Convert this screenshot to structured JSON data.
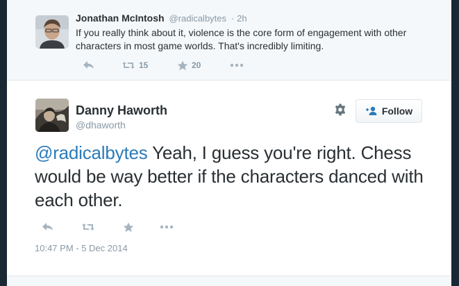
{
  "parent_tweet": {
    "author_name": "Jonathan McIntosh",
    "author_handle": "@radicalbytes",
    "separator": "·",
    "age": "2h",
    "text": "If you really think about it, violence is the core form of engagement with other characters in most game worlds. That's incredibly limiting.",
    "retweet_count": "15",
    "favorite_count": "20"
  },
  "main_tweet": {
    "author_name": "Danny Haworth",
    "author_handle": "@dhaworth",
    "follow_label": "Follow",
    "mention": "@radicalbytes",
    "text": " Yeah, I guess you're right. Chess would be way better if the characters danced with each other.",
    "timestamp": "10:47 PM - 5 Dec 2014"
  },
  "colors": {
    "link": "#2b7bb9",
    "icon": "#a6b4c0",
    "muted": "#8899a6",
    "text": "#292f33",
    "follow_accent": "#2b7bb9"
  }
}
